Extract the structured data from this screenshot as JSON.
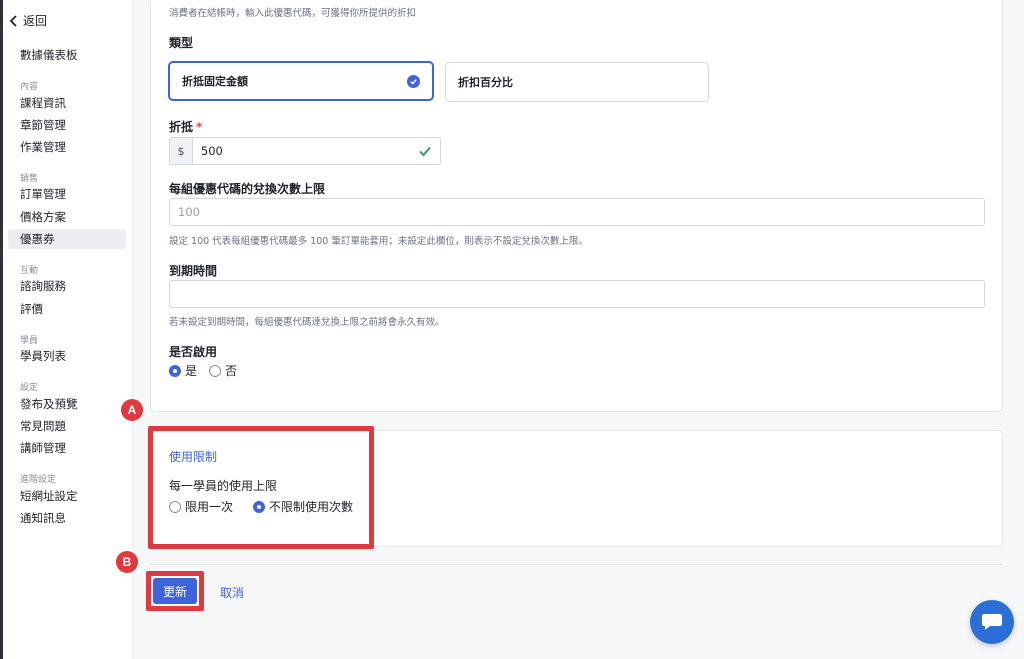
{
  "sidebar": {
    "back_label": "返回",
    "dashboard": "數據儀表板",
    "groups": [
      {
        "title": "內容",
        "items": [
          "課程資訊",
          "章節管理",
          "作業管理"
        ]
      },
      {
        "title": "銷售",
        "items": [
          "訂單管理",
          "價格方案",
          "優惠券"
        ]
      },
      {
        "title": "互動",
        "items": [
          "諮詢服務",
          "評價"
        ]
      },
      {
        "title": "學員",
        "items": [
          "學員列表"
        ]
      },
      {
        "title": "設定",
        "items": [
          "發布及預覽",
          "常見問題",
          "講師管理"
        ]
      },
      {
        "title": "進階設定",
        "items": [
          "短網址設定",
          "通知訊息"
        ]
      }
    ],
    "active_item": "優惠券"
  },
  "form": {
    "code_hint": "消費者在結帳時，輸入此優惠代碼，可獲得你所提供的折扣",
    "type_label": "類型",
    "type_options": [
      "折抵固定金額",
      "折扣百分比"
    ],
    "type_selected": "折抵固定金額",
    "discount_label": "折抵",
    "required_mark": "*",
    "currency_prefix": "$",
    "discount_value": "500",
    "limit_label": "每組優惠代碼的兌換次數上限",
    "limit_placeholder": "100",
    "limit_hint": "設定 100 代表每組優惠代碼最多 100 筆訂單能套用；未設定此欄位，則表示不設定兌換次數上限。",
    "expiry_label": "到期時間",
    "expiry_value": "",
    "expiry_hint": "若未設定到期時間，每組優惠代碼達兌換上限之前將會永久有效。",
    "enable_label": "是否啟用",
    "enable_options": [
      "是",
      "否"
    ],
    "enable_selected": "是"
  },
  "usage": {
    "section_title": "使用限制",
    "per_student_label": "每一學員的使用上限",
    "options": [
      "限用一次",
      "不限制使用次數"
    ],
    "selected": "不限制使用次數"
  },
  "annotations": {
    "marker_a": "A",
    "marker_b": "B"
  },
  "actions": {
    "update_label": "更新",
    "cancel_label": "取消"
  },
  "colors": {
    "primary": "#3e63dd",
    "annotation_red": "#e0393e",
    "chat_blue": "#2b6fd6",
    "valid_green": "#3aa05b"
  },
  "icons": {
    "back": "chevron-left-icon",
    "check": "check-icon",
    "chat": "chat-bubble-icon"
  }
}
